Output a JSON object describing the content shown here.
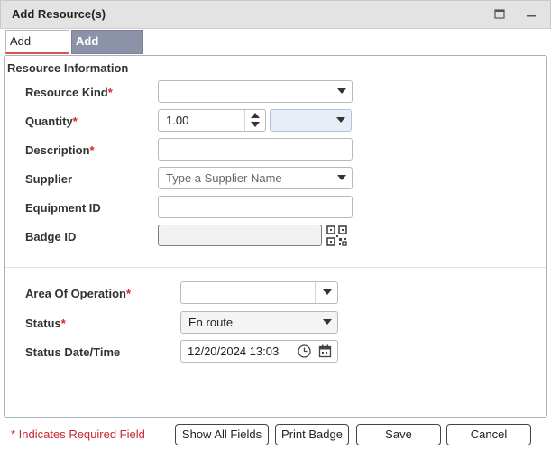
{
  "window": {
    "title": "Add Resource(s)"
  },
  "tabs": [
    {
      "label": "Add Single",
      "active": true
    },
    {
      "label": "Add Multiple",
      "active": false
    }
  ],
  "section": {
    "title": "Resource Information"
  },
  "fields": {
    "resource_kind": {
      "label": "Resource Kind",
      "required_mark": "*",
      "value": ""
    },
    "quantity": {
      "label": "Quantity",
      "required_mark": "*",
      "value": "1.00",
      "unit_value": ""
    },
    "description": {
      "label": "Description",
      "required_mark": "*",
      "value": ""
    },
    "supplier": {
      "label": "Supplier",
      "placeholder": "Type a Supplier Name"
    },
    "equipment_id": {
      "label": "Equipment ID",
      "value": ""
    },
    "badge_id": {
      "label": "Badge ID",
      "value": ""
    },
    "area_of_operation": {
      "label": "Area Of Operation",
      "required_mark": "*",
      "value": ""
    },
    "status": {
      "label": "Status",
      "required_mark": "*",
      "value": "En route"
    },
    "status_datetime": {
      "label": "Status Date/Time",
      "value": "12/20/2024 13:03"
    }
  },
  "footer": {
    "required_note": "* Indicates Required Field",
    "buttons": {
      "show_all_fields": "Show All Fields",
      "print_badge": "Print Badge",
      "save": "Save",
      "cancel": "Cancel"
    }
  },
  "icons": {
    "minimize": "minimize-icon",
    "maximize": "maximize-icon",
    "dropdown": "chevron-down-icon",
    "qr": "qr-code-icon",
    "clock": "clock-icon",
    "calendar": "calendar-icon"
  },
  "colors": {
    "tab_active_underline": "#d9534f",
    "tab_inactive_bg": "#8c93a8",
    "required": "#d9222a"
  }
}
